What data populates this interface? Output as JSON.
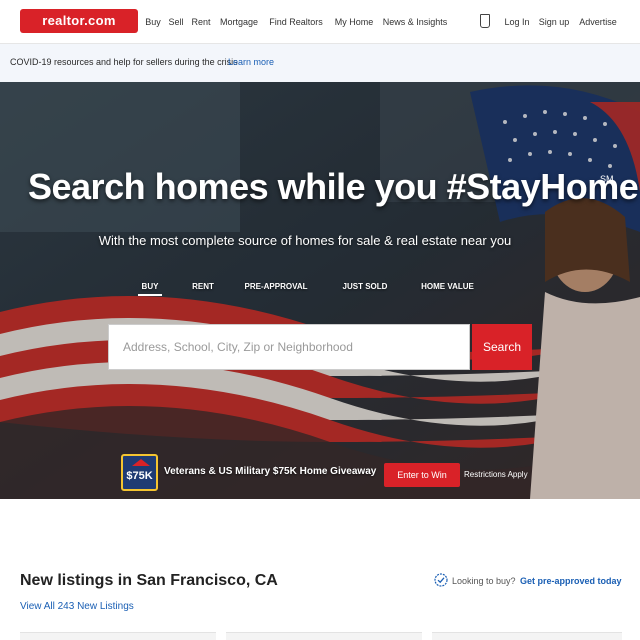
{
  "nav": {
    "logo_text": "realtor.com",
    "items": [
      "Buy",
      "Sell",
      "Rent",
      "Mortgage",
      "Find Realtors",
      "My Home",
      "News & Insights",
      "Log In",
      "Sign up",
      "Advertise"
    ]
  },
  "banner": {
    "text": "COVID-19 resources and help for sellers during the crisis",
    "link": "Learn more"
  },
  "hero": {
    "title": "Search homes while you #StayHome",
    "title_mark": "SM",
    "subtitle": "With the most complete source of homes for sale & real estate near you",
    "tabs": [
      "BUY",
      "RENT",
      "PRE-APPROVAL",
      "JUST SOLD",
      "HOME VALUE"
    ],
    "search_placeholder": "Address, School, City, Zip or Neighborhood",
    "search_button": "Search"
  },
  "promo": {
    "badge": "$75K",
    "text": "Veterans & US Military $75K Home Giveaway",
    "button": "Enter to Win",
    "note": "Restrictions Apply"
  },
  "listings": {
    "title": "New listings in San Francisco, CA",
    "looking_text": "Looking to buy?",
    "link": "Get pre-approved today",
    "view_all": "View All 243 New Listings"
  },
  "icons": {
    "verify": "check-badge-icon",
    "saved": "saved-homes-icon"
  },
  "colors": {
    "brand_red": "#d92228",
    "link_blue": "#1a5fb4"
  }
}
